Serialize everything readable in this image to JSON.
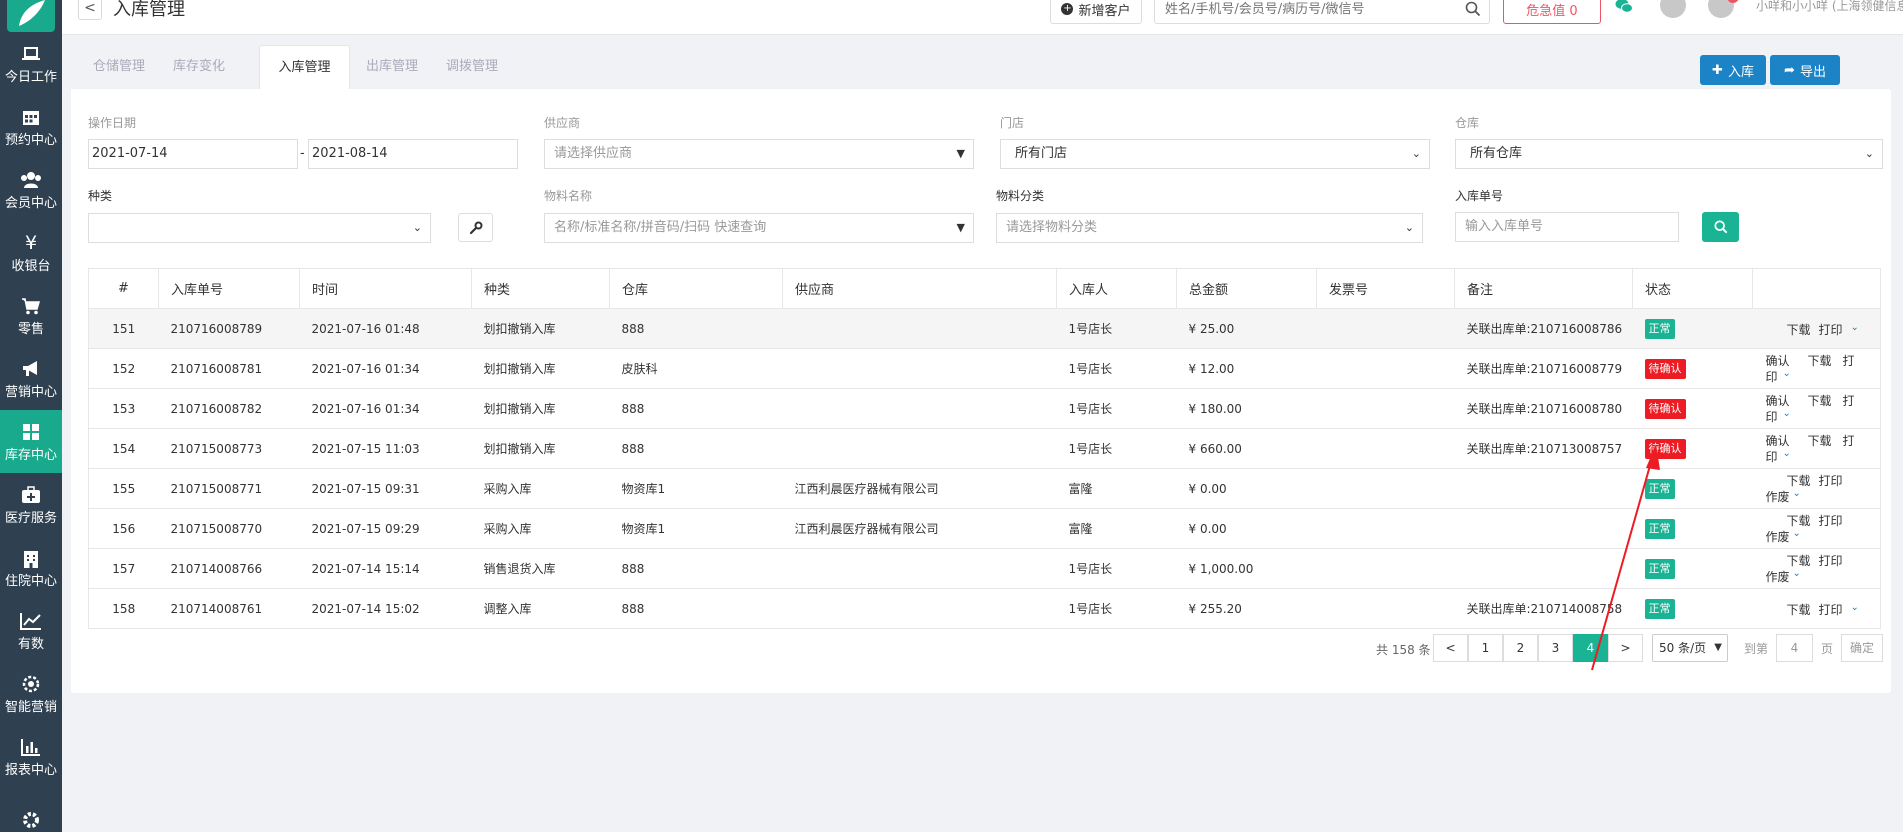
{
  "header": {
    "back_label": "<",
    "title": "入库管理",
    "new_customer": "新增客户",
    "search_placeholder": "姓名/手机号/会员号/病历号/微信号",
    "danger": "危急值 0",
    "user": "小咩和小小咩 (上海领健信息(总部)"
  },
  "sidebar": {
    "items": [
      {
        "label": "今日工作",
        "icon": "laptop-icon"
      },
      {
        "label": "预约中心",
        "icon": "calendar-icon"
      },
      {
        "label": "会员中心",
        "icon": "users-icon"
      },
      {
        "label": "收银台",
        "icon": "yen-icon"
      },
      {
        "label": "零售",
        "icon": "cart-icon"
      },
      {
        "label": "营销中心",
        "icon": "bullhorn-icon"
      },
      {
        "label": "库存中心",
        "icon": "grid-icon"
      },
      {
        "label": "医疗服务",
        "icon": "medkit-icon"
      },
      {
        "label": "住院中心",
        "icon": "hospital-icon"
      },
      {
        "label": "有数",
        "icon": "line-chart-icon"
      },
      {
        "label": "智能营销",
        "icon": "rocket-icon"
      },
      {
        "label": "报表中心",
        "icon": "bar-chart-icon"
      }
    ]
  },
  "tabs": [
    {
      "label": "仓储管理"
    },
    {
      "label": "库存变化"
    },
    {
      "label": "入库管理"
    },
    {
      "label": "出库管理"
    },
    {
      "label": "调拨管理"
    }
  ],
  "actions": {
    "in": "入库",
    "out": "导出"
  },
  "filters": {
    "date_label": "操作日期",
    "date_from": "2021-07-14",
    "date_sep": "-",
    "date_to": "2021-08-14",
    "supplier_label": "供应商",
    "supplier_placeholder": "请选择供应商",
    "store_label": "门店",
    "store_value": "所有门店",
    "warehouse_label": "仓库",
    "warehouse_value": "所有仓库",
    "kind_label": "种类",
    "kind_value": "",
    "material_label": "物料名称",
    "material_placeholder": "名称/标准名称/拼音码/扫码 快速查询",
    "category_label": "物料分类",
    "category_placeholder": "请选择物料分类",
    "order_label": "入库单号",
    "order_placeholder": "输入入库单号"
  },
  "table": {
    "columns": [
      "#",
      "入库单号",
      "时间",
      "种类",
      "仓库",
      "供应商",
      "入库人",
      "总金额",
      "发票号",
      "备注",
      "状态",
      ""
    ],
    "rows": [
      {
        "no": "151",
        "order": "210716008789",
        "time": "2021-07-16 01:48",
        "kind": "划扣撤销入库",
        "warehouse": "888",
        "supplier": "",
        "person": "1号店长",
        "amount": "¥ 25.00",
        "invoice": "",
        "note": "关联出库单:210716008786",
        "status": "正常",
        "status_type": "ok",
        "actions": [
          "下载",
          "打印"
        ]
      },
      {
        "no": "152",
        "order": "210716008781",
        "time": "2021-07-16 01:34",
        "kind": "划扣撤销入库",
        "warehouse": "皮肤科",
        "supplier": "",
        "person": "1号店长",
        "amount": "¥ 12.00",
        "invoice": "",
        "note": "关联出库单:210716008779",
        "status": "待确认",
        "status_type": "pend",
        "actions": [
          "确认",
          "下载",
          "打",
          "印"
        ]
      },
      {
        "no": "153",
        "order": "210716008782",
        "time": "2021-07-16 01:34",
        "kind": "划扣撤销入库",
        "warehouse": "888",
        "supplier": "",
        "person": "1号店长",
        "amount": "¥ 180.00",
        "invoice": "",
        "note": "关联出库单:210716008780",
        "status": "待确认",
        "status_type": "pend",
        "actions": [
          "确认",
          "下载",
          "打",
          "印"
        ]
      },
      {
        "no": "154",
        "order": "210715008773",
        "time": "2021-07-15 11:03",
        "kind": "划扣撤销入库",
        "warehouse": "888",
        "supplier": "",
        "person": "1号店长",
        "amount": "¥ 660.00",
        "invoice": "",
        "note": "关联出库单:210713008757",
        "status": "待确认",
        "status_type": "pend",
        "actions": [
          "确认",
          "下载",
          "打",
          "印"
        ]
      },
      {
        "no": "155",
        "order": "210715008771",
        "time": "2021-07-15 09:31",
        "kind": "采购入库",
        "warehouse": "物资库1",
        "supplier": "江西利晨医疗器械有限公司",
        "person": "富隆",
        "amount": "¥ 0.00",
        "invoice": "",
        "note": "",
        "status": "正常",
        "status_type": "ok",
        "actions": [
          "下载",
          "打印",
          "作废"
        ]
      },
      {
        "no": "156",
        "order": "210715008770",
        "time": "2021-07-15 09:29",
        "kind": "采购入库",
        "warehouse": "物资库1",
        "supplier": "江西利晨医疗器械有限公司",
        "person": "富隆",
        "amount": "¥ 0.00",
        "invoice": "",
        "note": "",
        "status": "正常",
        "status_type": "ok",
        "actions": [
          "下载",
          "打印",
          "作废"
        ]
      },
      {
        "no": "157",
        "order": "210714008766",
        "time": "2021-07-14 15:14",
        "kind": "销售退货入库",
        "warehouse": "888",
        "supplier": "",
        "person": "1号店长",
        "amount": "¥ 1,000.00",
        "invoice": "",
        "note": "",
        "status": "正常",
        "status_type": "ok",
        "actions": [
          "下载",
          "打印",
          "作废"
        ]
      },
      {
        "no": "158",
        "order": "210714008761",
        "time": "2021-07-14 15:02",
        "kind": "调整入库",
        "warehouse": "888",
        "supplier": "",
        "person": "1号店长",
        "amount": "¥ 255.20",
        "invoice": "",
        "note": "关联出库单:210714008758",
        "status": "正常",
        "status_type": "ok",
        "actions": [
          "下载",
          "打印"
        ]
      }
    ]
  },
  "pagination": {
    "total": "共 158 条",
    "prev": "<",
    "pages": [
      "1",
      "2",
      "3",
      "4"
    ],
    "current": "4",
    "next": ">",
    "per_page": "50 条/页",
    "goto_label": "到第",
    "goto_value": "4",
    "page_label": "页",
    "confirm": "确定"
  },
  "colors": {
    "sidebar": "#2f4050",
    "accent": "#1ab394",
    "primary": "#1c84c6",
    "danger": "#ed1c24"
  }
}
